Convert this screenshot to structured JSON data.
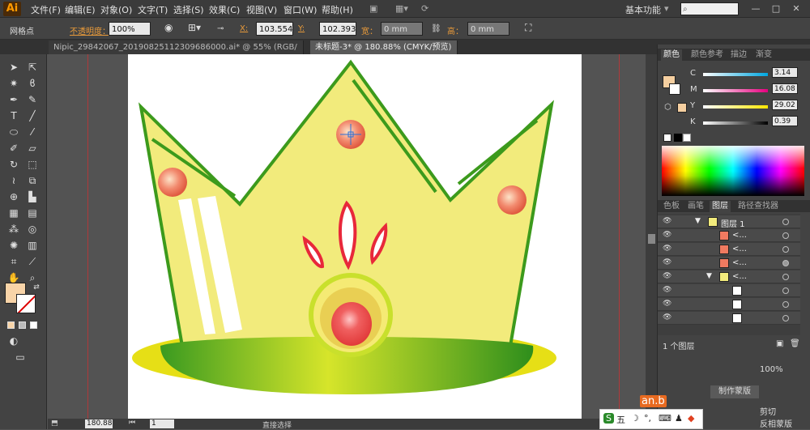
{
  "app": {
    "logo": "Ai",
    "workspace": "基本功能"
  },
  "menu": [
    "文件(F)",
    "编辑(E)",
    "对象(O)",
    "文字(T)",
    "选择(S)",
    "效果(C)",
    "视图(V)",
    "窗口(W)",
    "帮助(H)"
  ],
  "control": {
    "selection_label": "网格点",
    "opacity_label": "不透明度：",
    "opacity_value": "100%",
    "x_label": "X:",
    "x_value": "103.554",
    "y_label": "Y:",
    "y_value": "102.393",
    "w_label": "宽：",
    "w_value": "0 mm",
    "h_label": "高：",
    "h_value": "0 mm"
  },
  "tabs": [
    {
      "label": "Nipic_29842067_20190825112309686000.ai* @ 55% (RGB/预览)"
    },
    {
      "label": "未标题-3* @ 180.88% (CMYK/预览)"
    }
  ],
  "color_panel": {
    "tabs": [
      "颜色",
      "颜色参考",
      "描边",
      "渐变"
    ],
    "c": "3.14",
    "m": "16.08",
    "y": "29.02",
    "k": "0.39",
    "c_label": "C",
    "m_label": "M",
    "y_label": "Y",
    "k_label": "K",
    "swatch": "#f5cfa0"
  },
  "layers_panel": {
    "tabs": [
      "色板",
      "画笔",
      "图层",
      "路径查找器"
    ],
    "layer_name": "图层 1",
    "sublayer": "<...",
    "count": "1 个图层"
  },
  "status": {
    "zoom": "180.88",
    "page": "1",
    "tool": "直接选择"
  },
  "taskbar": {
    "ime": "五",
    "brand": "an.b",
    "btn1": "制作蒙版",
    "btn2": "剪切",
    "btn3": "反相蒙版",
    "pct": "100%"
  }
}
